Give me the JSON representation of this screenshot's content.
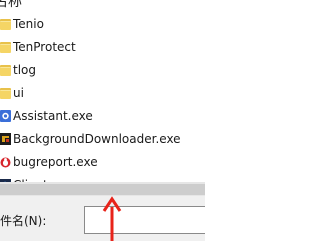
{
  "list": {
    "column_header": "名称",
    "items": [
      {
        "name": "Tenio",
        "icon": "folder-icon"
      },
      {
        "name": "TenProtect",
        "icon": "folder-icon"
      },
      {
        "name": "tlog",
        "icon": "folder-icon"
      },
      {
        "name": "ui",
        "icon": "folder-icon"
      },
      {
        "name": "Assistant.exe",
        "icon": "assistant-app-icon"
      },
      {
        "name": "BackgroundDownloader.exe",
        "icon": "downloader-app-icon"
      },
      {
        "name": "bugreport.exe",
        "icon": "bugreport-app-icon"
      },
      {
        "name": "Client.exe",
        "icon": "client-app-icon"
      }
    ]
  },
  "bottom": {
    "filename_label": "文件名(N):",
    "filename_value": ""
  },
  "colors": {
    "annotation_arrow": "#e8231a",
    "folder": "#f5d565"
  }
}
